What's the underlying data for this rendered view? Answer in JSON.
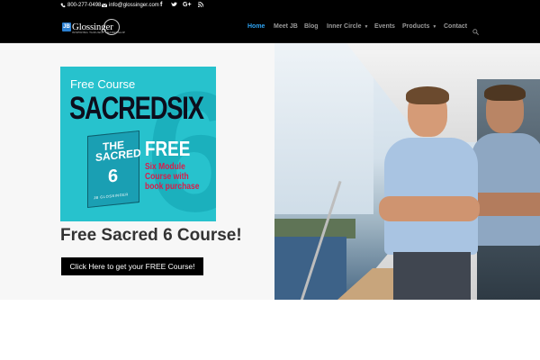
{
  "topbar": {
    "phone": "800-277-0498",
    "email": "info@glossinger.com",
    "social": [
      "f",
      "t",
      "G+",
      "rss"
    ]
  },
  "header": {
    "logo": {
      "brand": "Glossinger",
      "mark": "JB",
      "tagline": "INSPIRING THOUGHT LEADERSHIP"
    },
    "nav": [
      {
        "label": "Home",
        "active": true,
        "has_submenu": false
      },
      {
        "label": "Meet JB",
        "active": false,
        "has_submenu": false
      },
      {
        "label": "Blog",
        "active": false,
        "has_submenu": false
      },
      {
        "label": "Inner Circle",
        "active": false,
        "has_submenu": true
      },
      {
        "label": "Events",
        "active": false,
        "has_submenu": false
      },
      {
        "label": "Products",
        "active": false,
        "has_submenu": true
      },
      {
        "label": "Contact",
        "active": false,
        "has_submenu": false
      }
    ],
    "search_icon": "search-icon"
  },
  "promo": {
    "free_course": "Free Course",
    "title": "SACREDSIX",
    "book_title": "THE SACRED",
    "book_number": "6",
    "book_author": "JB GLOSSINGER",
    "free": "FREE",
    "subtitle": "Six Module Course with book purchase"
  },
  "main": {
    "course_title": "Free Sacred 6 Course!",
    "cta_label": "Click Here to get your FREE Course!"
  },
  "colors": {
    "accent": "#2ea3f2",
    "promo_bg": "#27c2cd",
    "promo_red": "#d81d4a",
    "header_bg": "#000000"
  }
}
